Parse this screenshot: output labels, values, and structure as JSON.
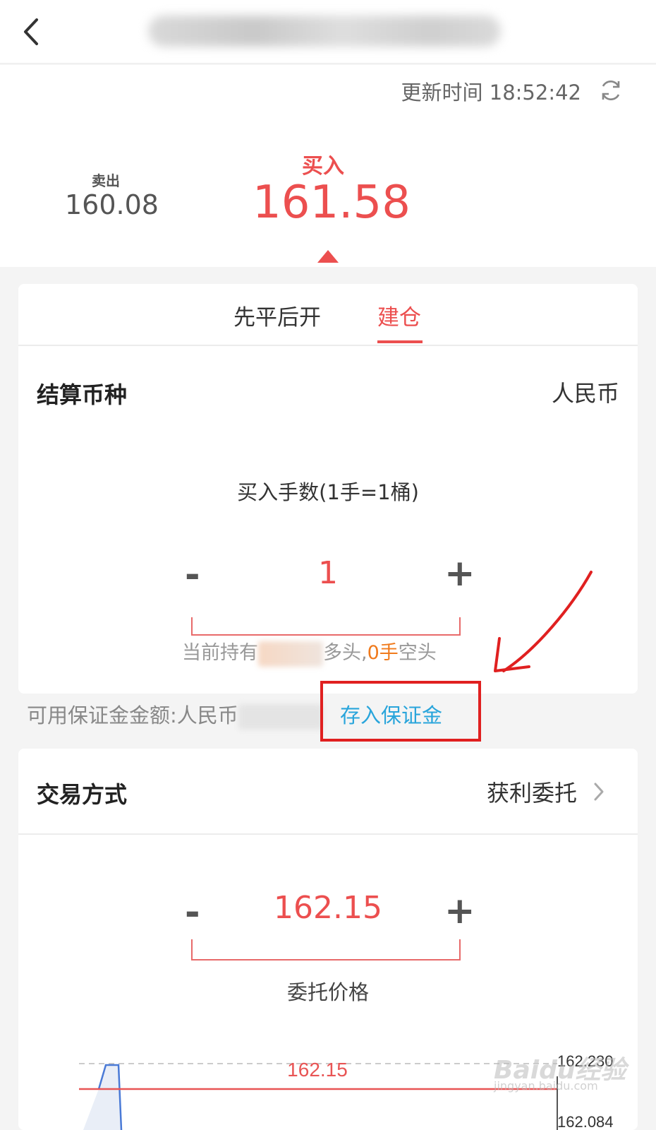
{
  "header": {
    "back_icon": "chevron-left-icon"
  },
  "quote": {
    "update_time_label": "更新时间",
    "update_time": "18:52:42",
    "refresh_icon": "refresh-icon",
    "sell_label": "卖出",
    "sell_price": "160.08",
    "buy_label": "买入",
    "buy_price": "161.58",
    "accent_color": "#ec4f4f"
  },
  "tabs": [
    {
      "label": "先平后开",
      "active": false
    },
    {
      "label": "建仓",
      "active": true
    }
  ],
  "settlement": {
    "label": "结算币种",
    "value": "人民币"
  },
  "quantity": {
    "label": "买入手数(1手=1桶)",
    "minus": "-",
    "value": "1",
    "plus": "+",
    "holding_prefix": "当前持有",
    "holding_long_suffix": "多头,",
    "holding_short_value": "0手",
    "holding_short_suffix": "空头"
  },
  "margin": {
    "label": "可用保证金金额:人民币",
    "deposit_link": "存入保证金",
    "link_color": "#29a5db"
  },
  "trade": {
    "label": "交易方式",
    "value": "获利委托",
    "chevron_icon": "chevron-right-icon",
    "price_minus": "-",
    "price_value": "162.15",
    "price_plus": "+",
    "price_label": "委托价格"
  },
  "mini_chart": {
    "price_line_label": "162.15",
    "top_tick": "162.230",
    "bottom_tick": "162.084"
  },
  "watermark": {
    "brand": "Baidu经验",
    "url": "jingyan.baidu.com"
  }
}
